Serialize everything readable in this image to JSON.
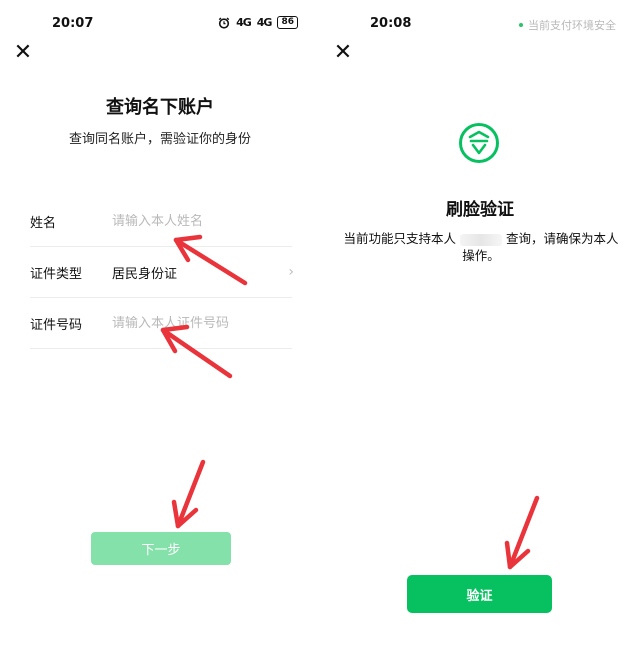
{
  "left_screen": {
    "status_time": "20:07",
    "signal_1": "4G",
    "signal_2": "4G",
    "battery": "86",
    "title": "查询名下账户",
    "subtitle": "查询同名账户，需验证你的身份",
    "fields": [
      {
        "label": "姓名",
        "placeholder": "请输入本人姓名"
      },
      {
        "label": "证件类型",
        "value": "居民身份证"
      },
      {
        "label": "证件号码",
        "placeholder": "请输入本人证件号码"
      }
    ],
    "next_button": "下一步"
  },
  "right_screen": {
    "status_time": "20:08",
    "secure_text": "当前支付环境安全",
    "title": "刷脸验证",
    "desc_part1": "当前功能只支持本人",
    "desc_part2": "查询，请确保为本人操作。",
    "verify_button": "验证"
  },
  "colors": {
    "accent": "#07c160",
    "disabled": "#85e1aa",
    "arrow": "#e8343a"
  },
  "icons": [
    "close-icon",
    "alarm-icon",
    "signal-icon",
    "battery-icon",
    "chevron-right-icon",
    "face-verify-logo-icon",
    "arrow-annotation-icon"
  ]
}
